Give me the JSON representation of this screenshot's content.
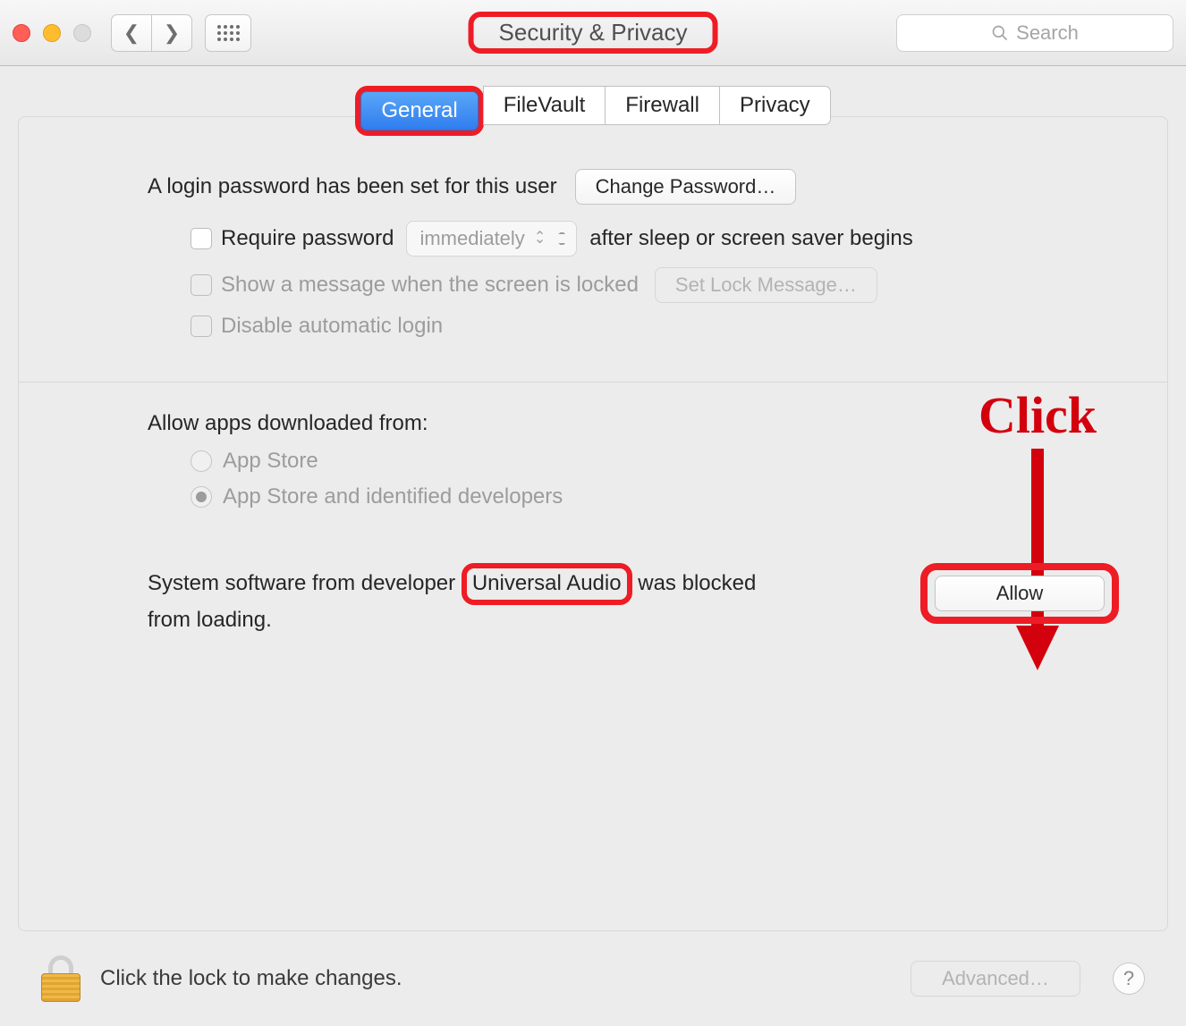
{
  "window": {
    "title": "Security & Privacy"
  },
  "toolbar": {
    "search_placeholder": "Search"
  },
  "tabs": {
    "general": "General",
    "filevault": "FileVault",
    "firewall": "Firewall",
    "privacy": "Privacy",
    "active": "general"
  },
  "login": {
    "password_set_text": "A login password has been set for this user",
    "change_password_btn": "Change Password…",
    "require_password_label": "Require password",
    "require_password_delay": "immediately",
    "require_password_suffix": "after sleep or screen saver begins",
    "show_message_label": "Show a message when the screen is locked",
    "set_lock_message_btn": "Set Lock Message…",
    "disable_auto_login_label": "Disable automatic login"
  },
  "gatekeeper": {
    "section_title": "Allow apps downloaded from:",
    "option_appstore": "App Store",
    "option_identified": "App Store and identified developers",
    "selected": "identified"
  },
  "blocked": {
    "prefix": "System software from developer",
    "developer": "Universal Audio",
    "suffix": "was blocked from loading.",
    "allow_btn": "Allow"
  },
  "annotation": {
    "click_label": "Click"
  },
  "footer": {
    "lock_hint": "Click the lock to make changes.",
    "advanced_btn": "Advanced…",
    "help_label": "?"
  }
}
